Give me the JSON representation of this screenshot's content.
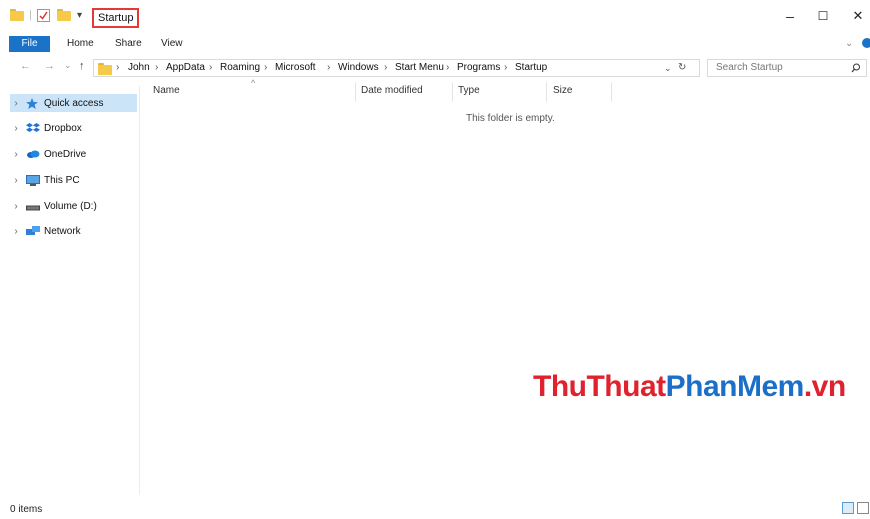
{
  "window": {
    "title": "Startup",
    "minimize_glyph": "–",
    "maximize_glyph": "☐",
    "close_glyph": "✕"
  },
  "ribbon": {
    "tabs": [
      "File",
      "Home",
      "Share",
      "View"
    ],
    "expand_glyph": "⌄"
  },
  "address": {
    "path": [
      "John",
      "AppData",
      "Roaming",
      "Microsoft",
      "Windows",
      "Start Menu",
      "Programs",
      "Startup"
    ],
    "separator": "›"
  },
  "search": {
    "placeholder": "Search Startup"
  },
  "sidebar": {
    "items": [
      {
        "label": "Quick access",
        "icon": "star-icon",
        "selected": true
      },
      {
        "label": "Dropbox",
        "icon": "dropbox-icon"
      },
      {
        "label": "OneDrive",
        "icon": "onedrive-icon"
      },
      {
        "label": "This PC",
        "icon": "computer-icon"
      },
      {
        "label": "Volume (D:)",
        "icon": "drive-icon"
      },
      {
        "label": "Network",
        "icon": "network-icon"
      }
    ]
  },
  "columns": [
    "Name",
    "Date modified",
    "Type",
    "Size"
  ],
  "content": {
    "empty_message": "This folder is empty."
  },
  "watermark": {
    "part1": "ThuThuat",
    "part2": "PhanMem",
    "part3": ".vn"
  },
  "status": {
    "items_count": "0 items"
  },
  "colors": {
    "accent": "#1a73c7",
    "highlight_box": "#e53935",
    "selected_bg": "#cce4f7",
    "watermark_red": "#e0212e",
    "watermark_blue": "#1c6fc9"
  }
}
